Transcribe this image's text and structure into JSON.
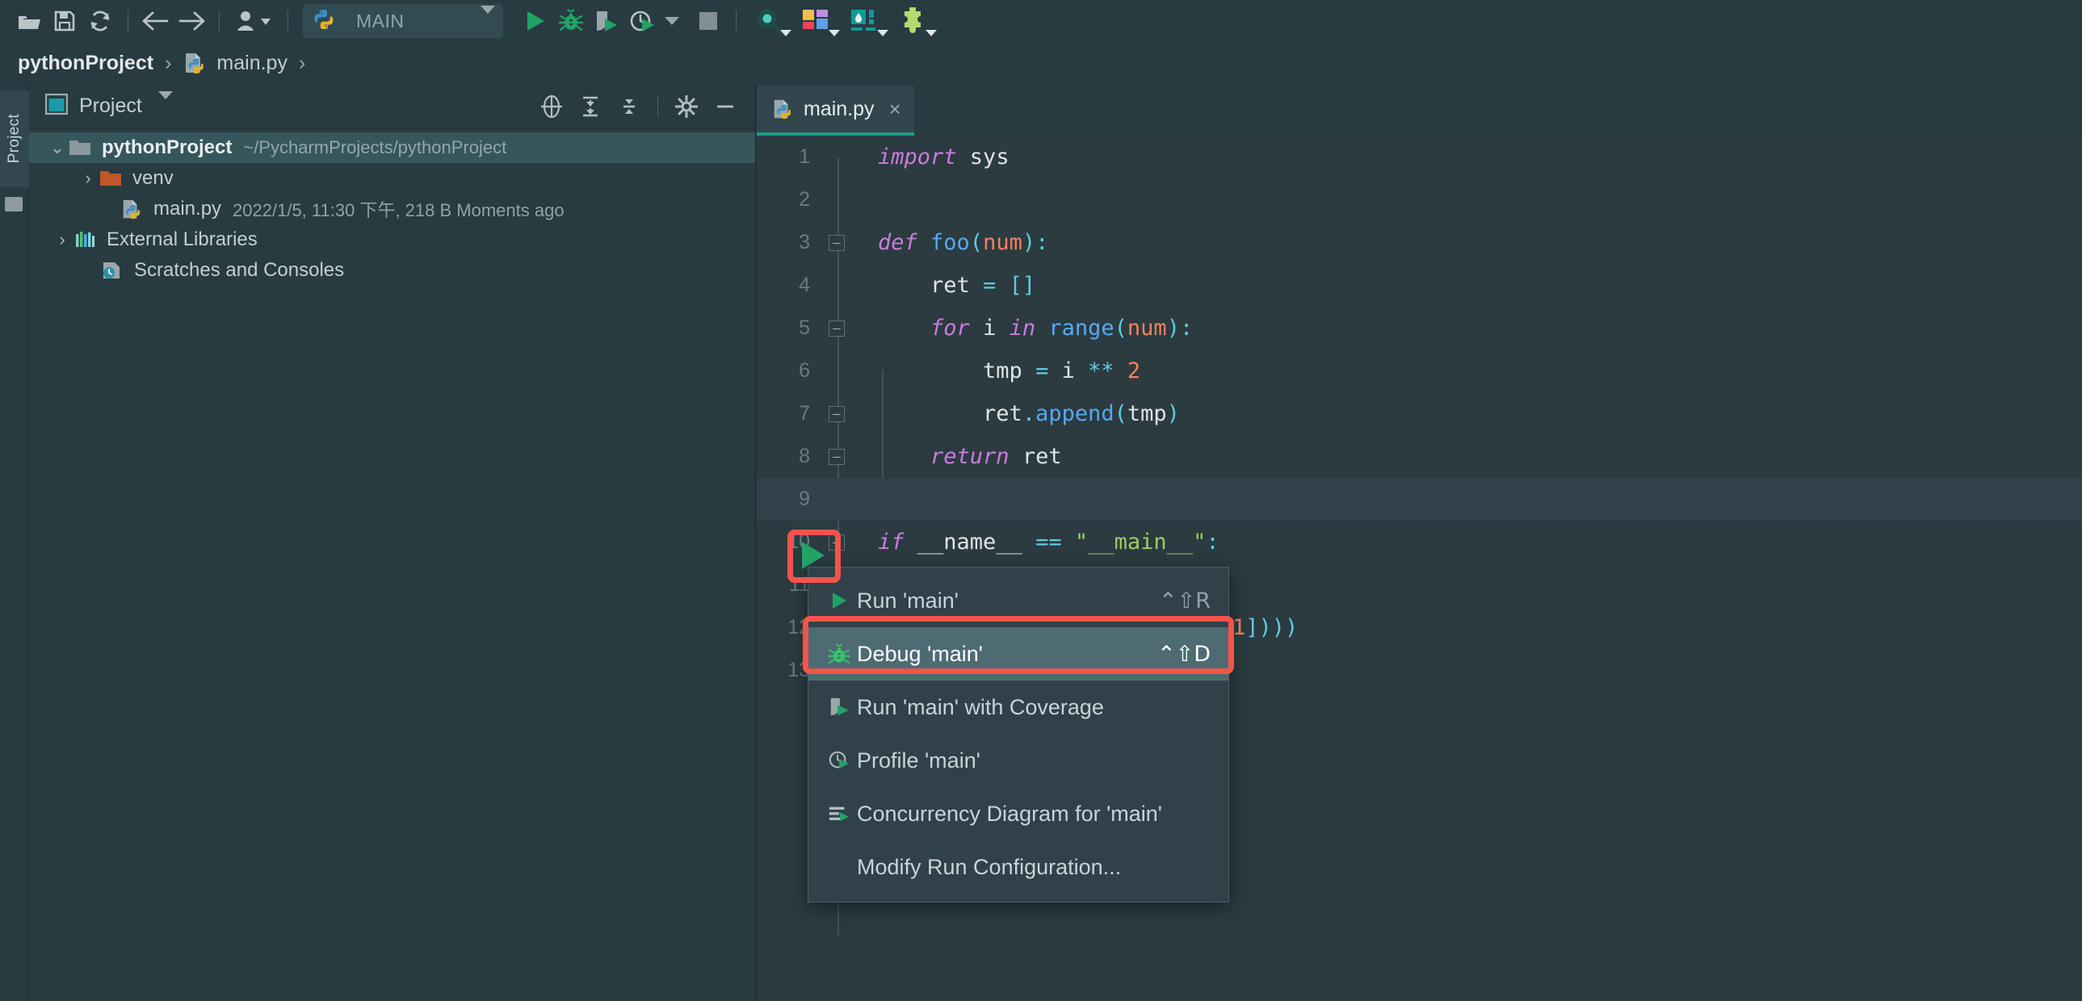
{
  "toolbar": {
    "icons": [
      {
        "name": "open-folder-icon",
        "title": "Open"
      },
      {
        "name": "save-icon",
        "title": "Save All"
      },
      {
        "name": "sync-icon",
        "title": "Synchronize"
      },
      {
        "name": "back-arrow-icon",
        "title": "Back"
      },
      {
        "name": "forward-arrow-icon",
        "title": "Forward"
      },
      {
        "name": "user-vcs-icon",
        "title": "VCS Operations"
      }
    ],
    "run_config": {
      "label": "MAIN",
      "icon": "python-file-icon"
    },
    "actions": [
      {
        "name": "run-button",
        "title": "Run"
      },
      {
        "name": "debug-button",
        "title": "Debug"
      },
      {
        "name": "run-with-coverage-button",
        "title": "Run with Coverage"
      },
      {
        "name": "profile-button",
        "title": "Profile"
      },
      {
        "name": "stop-button",
        "title": "Stop"
      }
    ],
    "right_icons": [
      {
        "name": "search-everywhere-icon",
        "title": "Search Everywhere"
      },
      {
        "name": "layout-icon",
        "title": "Layout"
      },
      {
        "name": "database-icon",
        "title": "Database"
      },
      {
        "name": "plugins-icon",
        "title": "Plugins"
      }
    ]
  },
  "breadcrumb": {
    "project": "pythonProject",
    "separator": "›",
    "file": "main.py",
    "trailing_separator": "›"
  },
  "left_strip": {
    "tab_label": "Project"
  },
  "project_panel": {
    "title": "Project",
    "tools": [
      {
        "name": "select-opened-file-icon",
        "title": "Select Opened File"
      },
      {
        "name": "expand-all-icon",
        "title": "Expand All"
      },
      {
        "name": "collapse-all-icon",
        "title": "Collapse All"
      },
      {
        "name": "settings-gear-icon",
        "title": "Settings"
      },
      {
        "name": "hide-panel-icon",
        "title": "Hide"
      }
    ],
    "tree": [
      {
        "label": "pythonProject",
        "meta": "~/PycharmProjects/pythonProject",
        "icon": "folder-icon",
        "twisty": "⌄",
        "expanded": true,
        "selected": true,
        "indent": 0,
        "bold": true
      },
      {
        "label": "venv",
        "meta": "",
        "icon": "folder-orange-icon",
        "twisty": "›",
        "expanded": false,
        "selected": false,
        "indent": 1,
        "bold": false
      },
      {
        "label": "main.py",
        "meta": "2022/1/5, 11:30 下午, 218 B Moments ago",
        "icon": "python-file-icon",
        "twisty": "",
        "expanded": false,
        "selected": false,
        "indent": 1,
        "bold": false
      },
      {
        "label": "External Libraries",
        "meta": "",
        "icon": "libraries-icon",
        "twisty": "›",
        "expanded": false,
        "selected": false,
        "indent": 0,
        "bold": false
      },
      {
        "label": "Scratches and Consoles",
        "meta": "",
        "icon": "scratches-icon",
        "twisty": "",
        "expanded": false,
        "selected": false,
        "indent": 0,
        "bold": false
      }
    ]
  },
  "editor": {
    "tab": {
      "label": "main.py",
      "close": "×",
      "icon": "python-file-icon"
    },
    "current_line": 9,
    "lines": [
      {
        "n": "1",
        "text": "import sys"
      },
      {
        "n": "2",
        "text": ""
      },
      {
        "n": "3",
        "text": "def foo(num):"
      },
      {
        "n": "4",
        "text": "    ret = []"
      },
      {
        "n": "5",
        "text": "    for i in range(num):"
      },
      {
        "n": "6",
        "text": "        tmp = i ** 2"
      },
      {
        "n": "7",
        "text": "        ret.append(tmp)"
      },
      {
        "n": "8",
        "text": "    return ret"
      },
      {
        "n": "9",
        "text": ""
      },
      {
        "n": "10",
        "text": "if __name__ == \"__main__\":"
      },
      {
        "n": "11",
        "text": ""
      },
      {
        "n": "12",
        "text": "    print(foo(int(sys.argv[1])))"
      },
      {
        "n": "13",
        "text": ""
      }
    ],
    "line12_tail": "[1]))"
  },
  "context_menu": {
    "items": [
      {
        "label": "Run 'main'",
        "shortcut": "⌃⇧R",
        "icon": "run-icon",
        "highlight": false
      },
      {
        "label": "Debug 'main'",
        "shortcut": "⌃⇧D",
        "icon": "debug-bug-icon",
        "highlight": true
      },
      {
        "label": "Run 'main' with Coverage",
        "shortcut": "",
        "icon": "coverage-icon",
        "highlight": false
      },
      {
        "label": "Profile 'main'",
        "shortcut": "",
        "icon": "profile-icon",
        "highlight": false
      },
      {
        "label": "Concurrency Diagram for 'main'",
        "shortcut": "",
        "icon": "concurrency-icon",
        "highlight": false
      },
      {
        "label": "Modify Run Configuration...",
        "shortcut": "",
        "icon": "",
        "highlight": false
      }
    ]
  },
  "colors": {
    "background": "#283b41",
    "editor_background": "#2b3b40",
    "accent_green": "#21a366",
    "highlight_red": "#f4544a",
    "selection": "#35565a",
    "tab_underline": "#1d9b8a"
  }
}
